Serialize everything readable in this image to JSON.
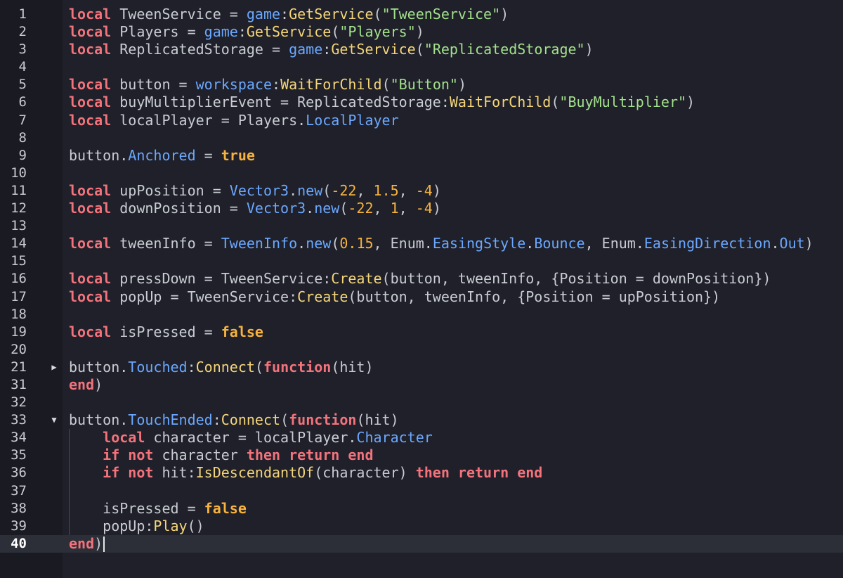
{
  "editor": {
    "language": "lua",
    "current_line": "40",
    "colors": {
      "background": "#1f2029",
      "keyword": "#f3737c",
      "string": "#a3e08c",
      "number": "#f7b33d",
      "property": "#6ba8ff",
      "method": "#f5d67a"
    },
    "lines": [
      {
        "n": "1",
        "tokens": [
          [
            "kw",
            "local"
          ],
          [
            "op",
            " TweenService = "
          ],
          [
            "svc",
            "game"
          ],
          [
            "op",
            ":"
          ],
          [
            "meth",
            "GetService"
          ],
          [
            "op",
            "("
          ],
          [
            "str",
            "\"TweenService\""
          ],
          [
            "op",
            ")"
          ]
        ]
      },
      {
        "n": "2",
        "tokens": [
          [
            "kw",
            "local"
          ],
          [
            "op",
            " Players = "
          ],
          [
            "svc",
            "game"
          ],
          [
            "op",
            ":"
          ],
          [
            "meth",
            "GetService"
          ],
          [
            "op",
            "("
          ],
          [
            "str",
            "\"Players\""
          ],
          [
            "op",
            ")"
          ]
        ]
      },
      {
        "n": "3",
        "tokens": [
          [
            "kw",
            "local"
          ],
          [
            "op",
            " ReplicatedStorage = "
          ],
          [
            "svc",
            "game"
          ],
          [
            "op",
            ":"
          ],
          [
            "meth",
            "GetService"
          ],
          [
            "op",
            "("
          ],
          [
            "str",
            "\"ReplicatedStorage\""
          ],
          [
            "op",
            ")"
          ]
        ]
      },
      {
        "n": "4",
        "tokens": []
      },
      {
        "n": "5",
        "tokens": [
          [
            "kw",
            "local"
          ],
          [
            "op",
            " button = "
          ],
          [
            "svc",
            "workspace"
          ],
          [
            "op",
            ":"
          ],
          [
            "meth",
            "WaitForChild"
          ],
          [
            "op",
            "("
          ],
          [
            "str",
            "\"Button\""
          ],
          [
            "op",
            ")"
          ]
        ]
      },
      {
        "n": "6",
        "tokens": [
          [
            "kw",
            "local"
          ],
          [
            "op",
            " buyMultiplierEvent = ReplicatedStorage:"
          ],
          [
            "meth",
            "WaitForChild"
          ],
          [
            "op",
            "("
          ],
          [
            "str",
            "\"BuyMultiplier\""
          ],
          [
            "op",
            ")"
          ]
        ]
      },
      {
        "n": "7",
        "tokens": [
          [
            "kw",
            "local"
          ],
          [
            "op",
            " localPlayer = Players."
          ],
          [
            "prop",
            "LocalPlayer"
          ]
        ]
      },
      {
        "n": "8",
        "tokens": []
      },
      {
        "n": "9",
        "tokens": [
          [
            "op",
            "button."
          ],
          [
            "prop",
            "Anchored"
          ],
          [
            "op",
            " = "
          ],
          [
            "bool",
            "true"
          ]
        ]
      },
      {
        "n": "10",
        "tokens": []
      },
      {
        "n": "11",
        "tokens": [
          [
            "kw",
            "local"
          ],
          [
            "op",
            " upPosition = "
          ],
          [
            "svc",
            "Vector3"
          ],
          [
            "op",
            "."
          ],
          [
            "svc",
            "new"
          ],
          [
            "op",
            "("
          ],
          [
            "num-lit",
            "-22"
          ],
          [
            "op",
            ", "
          ],
          [
            "num-lit",
            "1.5"
          ],
          [
            "op",
            ", "
          ],
          [
            "num-lit",
            "-4"
          ],
          [
            "op",
            ")"
          ]
        ]
      },
      {
        "n": "12",
        "tokens": [
          [
            "kw",
            "local"
          ],
          [
            "op",
            " downPosition = "
          ],
          [
            "svc",
            "Vector3"
          ],
          [
            "op",
            "."
          ],
          [
            "svc",
            "new"
          ],
          [
            "op",
            "("
          ],
          [
            "num-lit",
            "-22"
          ],
          [
            "op",
            ", "
          ],
          [
            "num-lit",
            "1"
          ],
          [
            "op",
            ", "
          ],
          [
            "num-lit",
            "-4"
          ],
          [
            "op",
            ")"
          ]
        ]
      },
      {
        "n": "13",
        "tokens": []
      },
      {
        "n": "14",
        "tokens": [
          [
            "kw",
            "local"
          ],
          [
            "op",
            " tweenInfo = "
          ],
          [
            "svc",
            "TweenInfo"
          ],
          [
            "op",
            "."
          ],
          [
            "svc",
            "new"
          ],
          [
            "op",
            "("
          ],
          [
            "num-lit",
            "0.15"
          ],
          [
            "op",
            ", Enum."
          ],
          [
            "svc",
            "EasingStyle"
          ],
          [
            "op",
            "."
          ],
          [
            "svc",
            "Bounce"
          ],
          [
            "op",
            ", Enum."
          ],
          [
            "svc",
            "EasingDirection"
          ],
          [
            "op",
            "."
          ],
          [
            "svc",
            "Out"
          ],
          [
            "op",
            ")"
          ]
        ]
      },
      {
        "n": "15",
        "tokens": []
      },
      {
        "n": "16",
        "tokens": [
          [
            "kw",
            "local"
          ],
          [
            "op",
            " pressDown = TweenService:"
          ],
          [
            "meth",
            "Create"
          ],
          [
            "op",
            "(button, tweenInfo, {Position = downPosition})"
          ]
        ]
      },
      {
        "n": "17",
        "tokens": [
          [
            "kw",
            "local"
          ],
          [
            "op",
            " popUp = TweenService:"
          ],
          [
            "meth",
            "Create"
          ],
          [
            "op",
            "(button, tweenInfo, {Position = upPosition})"
          ]
        ]
      },
      {
        "n": "18",
        "tokens": []
      },
      {
        "n": "19",
        "tokens": [
          [
            "kw",
            "local"
          ],
          [
            "op",
            " isPressed = "
          ],
          [
            "bool",
            "false"
          ]
        ]
      },
      {
        "n": "20",
        "tokens": []
      },
      {
        "n": "21",
        "fold": "collapsed",
        "tokens": [
          [
            "op",
            "button."
          ],
          [
            "prop",
            "Touched"
          ],
          [
            "op",
            ":"
          ],
          [
            "meth",
            "Connect"
          ],
          [
            "op",
            "("
          ],
          [
            "kw",
            "function"
          ],
          [
            "op",
            "(hit)"
          ]
        ]
      },
      {
        "n": "31",
        "tokens": [
          [
            "kw",
            "end"
          ],
          [
            "op",
            ")"
          ]
        ]
      },
      {
        "n": "32",
        "tokens": []
      },
      {
        "n": "33",
        "fold": "expanded",
        "tokens": [
          [
            "op",
            "button."
          ],
          [
            "prop",
            "TouchEnded"
          ],
          [
            "op",
            ":"
          ],
          [
            "meth",
            "Connect"
          ],
          [
            "op",
            "("
          ],
          [
            "kw",
            "function"
          ],
          [
            "op",
            "(hit)"
          ]
        ]
      },
      {
        "n": "34",
        "indent": true,
        "tokens": [
          [
            "op",
            "    "
          ],
          [
            "kw",
            "local"
          ],
          [
            "op",
            " character = localPlayer."
          ],
          [
            "prop",
            "Character"
          ]
        ]
      },
      {
        "n": "35",
        "indent": true,
        "tokens": [
          [
            "op",
            "    "
          ],
          [
            "kw",
            "if not"
          ],
          [
            "op",
            " character "
          ],
          [
            "kw",
            "then return end"
          ]
        ]
      },
      {
        "n": "36",
        "indent": true,
        "tokens": [
          [
            "op",
            "    "
          ],
          [
            "kw",
            "if not"
          ],
          [
            "op",
            " hit:"
          ],
          [
            "meth",
            "IsDescendantOf"
          ],
          [
            "op",
            "(character) "
          ],
          [
            "kw",
            "then return end"
          ]
        ]
      },
      {
        "n": "37",
        "indent": true,
        "tokens": []
      },
      {
        "n": "38",
        "indent": true,
        "tokens": [
          [
            "op",
            "    isPressed = "
          ],
          [
            "bool",
            "false"
          ]
        ]
      },
      {
        "n": "39",
        "indent": true,
        "tokens": [
          [
            "op",
            "    popUp:"
          ],
          [
            "meth",
            "Play"
          ],
          [
            "op",
            "()"
          ]
        ]
      },
      {
        "n": "40",
        "current": true,
        "tokens": [
          [
            "kw",
            "end"
          ],
          [
            "op",
            ")"
          ]
        ]
      }
    ]
  }
}
